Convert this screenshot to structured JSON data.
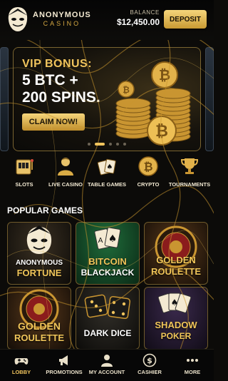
{
  "header": {
    "brand_name": "ANONYMOUS",
    "brand_sub": "CASINO",
    "balance_label": "BALANCE",
    "balance_value": "$12,450.00",
    "deposit_label": "DEPOSIT"
  },
  "banner": {
    "title": "VIP BONUS:",
    "line2": "5 BTC +",
    "line3": "200 SPINS.",
    "cta_label": "CLAIM NOW!",
    "slide_count": 5,
    "active_slide": 1
  },
  "categories": [
    {
      "label": "SLOTS",
      "icon": "slot-machine-icon"
    },
    {
      "label": "LIVE CASINO",
      "icon": "dealer-icon"
    },
    {
      "label": "TABLE GAMES",
      "icon": "cards-icon"
    },
    {
      "label": "CRYPTO",
      "icon": "bitcoin-icon"
    },
    {
      "label": "TOURNAMENTS",
      "icon": "trophy-icon"
    }
  ],
  "popular": {
    "title": "POPULAR GAMES",
    "games": [
      {
        "line1": "ANONYMOUS",
        "line2": "FORTUNE"
      },
      {
        "line1": "BITCOIN",
        "line2": "BLACKJACK"
      },
      {
        "line1": "GOLDEN",
        "line2": "ROULETTE"
      },
      {
        "line1": "GOLDEN",
        "line2": "ROULETTE"
      },
      {
        "line1": "DARK DICE",
        "line2": ""
      },
      {
        "line1": "SHADOW",
        "line2": "POKER"
      }
    ]
  },
  "nav": [
    {
      "label": "LOBBY",
      "icon": "gamepad-icon",
      "active": true
    },
    {
      "label": "PROMOTIONS",
      "icon": "megaphone-icon"
    },
    {
      "label": "MY ACCOUNT",
      "icon": "user-icon"
    },
    {
      "label": "CASHIER",
      "icon": "dollar-coin-icon"
    },
    {
      "label": "MORE",
      "icon": "more-dots-icon"
    }
  ],
  "colors": {
    "gold": "#f0c45d",
    "background": "#0c0b09",
    "button": "#d9ab45"
  }
}
